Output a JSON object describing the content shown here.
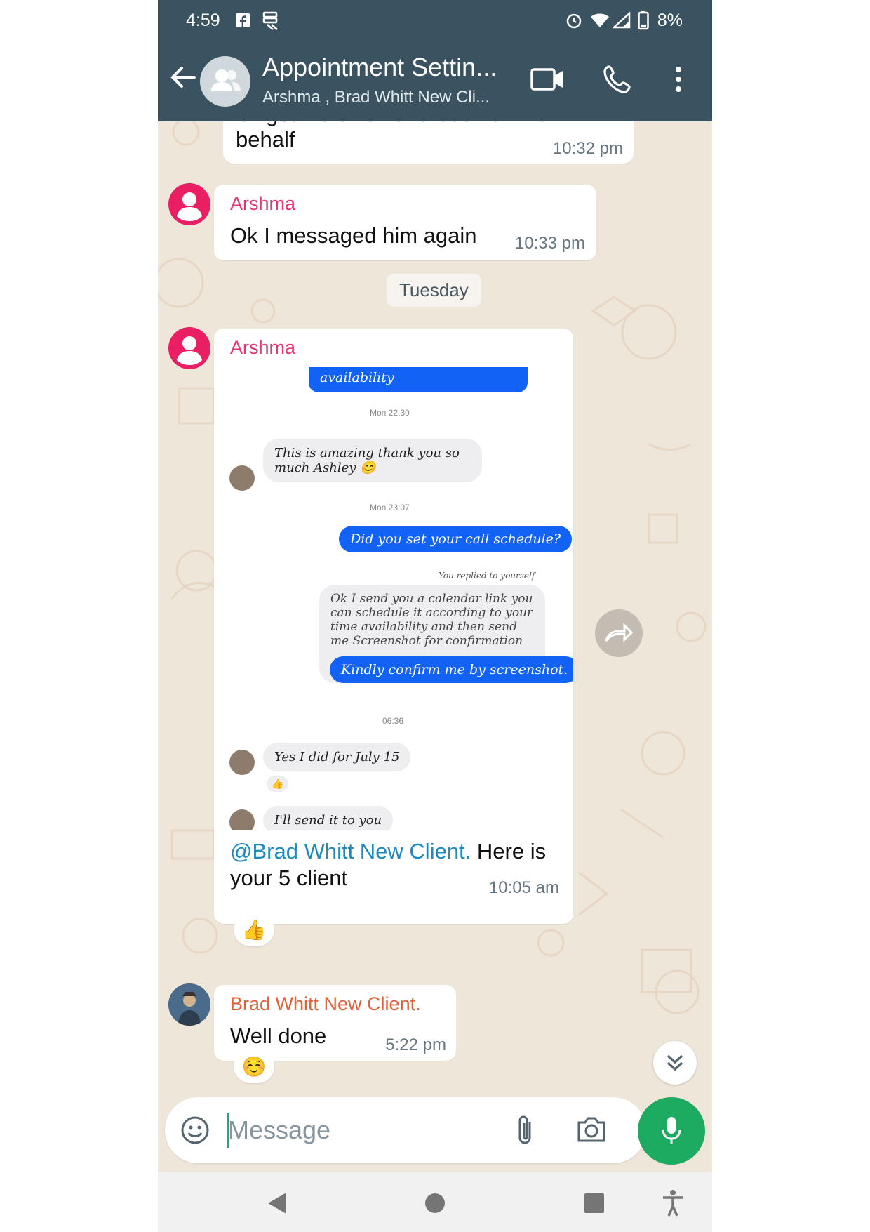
{
  "status_bar": {
    "time": "4:59",
    "battery": "8%",
    "icons": [
      "facebook-icon",
      "server-icon",
      "alarm-icon",
      "wifi-icon",
      "signal-icon",
      "battery-icon"
    ]
  },
  "header": {
    "title": "Appointment Settin...",
    "subtitle": "Arshma , Brad Whitt New Cli...",
    "icons": [
      "back-arrow-icon",
      "group-avatar-icon",
      "video-call-icon",
      "voice-call-icon",
      "more-vert-icon"
    ]
  },
  "messages": {
    "m1": {
      "partial_line": "Or get his email and book on his",
      "text": "behalf",
      "time": "10:32 pm"
    },
    "m2": {
      "sender": "Arshma",
      "text": "Ok I messaged him again",
      "time": "10:33 pm"
    },
    "date_divider": "Tuesday",
    "m3": {
      "sender": "Arshma",
      "screenshot": {
        "b1": "availability",
        "t1": "Mon 22:30",
        "b2": "This is amazing thank you so much Ashley 😊",
        "t2": "Mon 23:07",
        "b3": "Did you set your call schedule?",
        "replied": "You replied to yourself",
        "b4": "Ok I send you a calendar link you can schedule it according to your time availability and then send me Screenshot for confirmation",
        "b5": "Kindly confirm me by screenshot.",
        "t3": "06:36",
        "b6": "Yes I did for July 15",
        "b6_reaction": "👍",
        "b7": "I'll send it to you"
      },
      "mention": "@Brad Whitt New Client.",
      "text_rest": " Here is",
      "text_line2": "your 5 client",
      "time": "10:05 am",
      "reaction": "👍"
    },
    "m4": {
      "sender": "Brad Whitt New Client.",
      "text": "Well done",
      "time": "5:22 pm",
      "reaction": "☺️"
    }
  },
  "input": {
    "placeholder": "Message"
  },
  "colors": {
    "header": "#3b5361",
    "chat_bg": "#efe6da",
    "arshma_name": "#e8336e",
    "brad_name": "#e0623a",
    "mention": "#1f8ac0",
    "mic": "#1daa61"
  }
}
